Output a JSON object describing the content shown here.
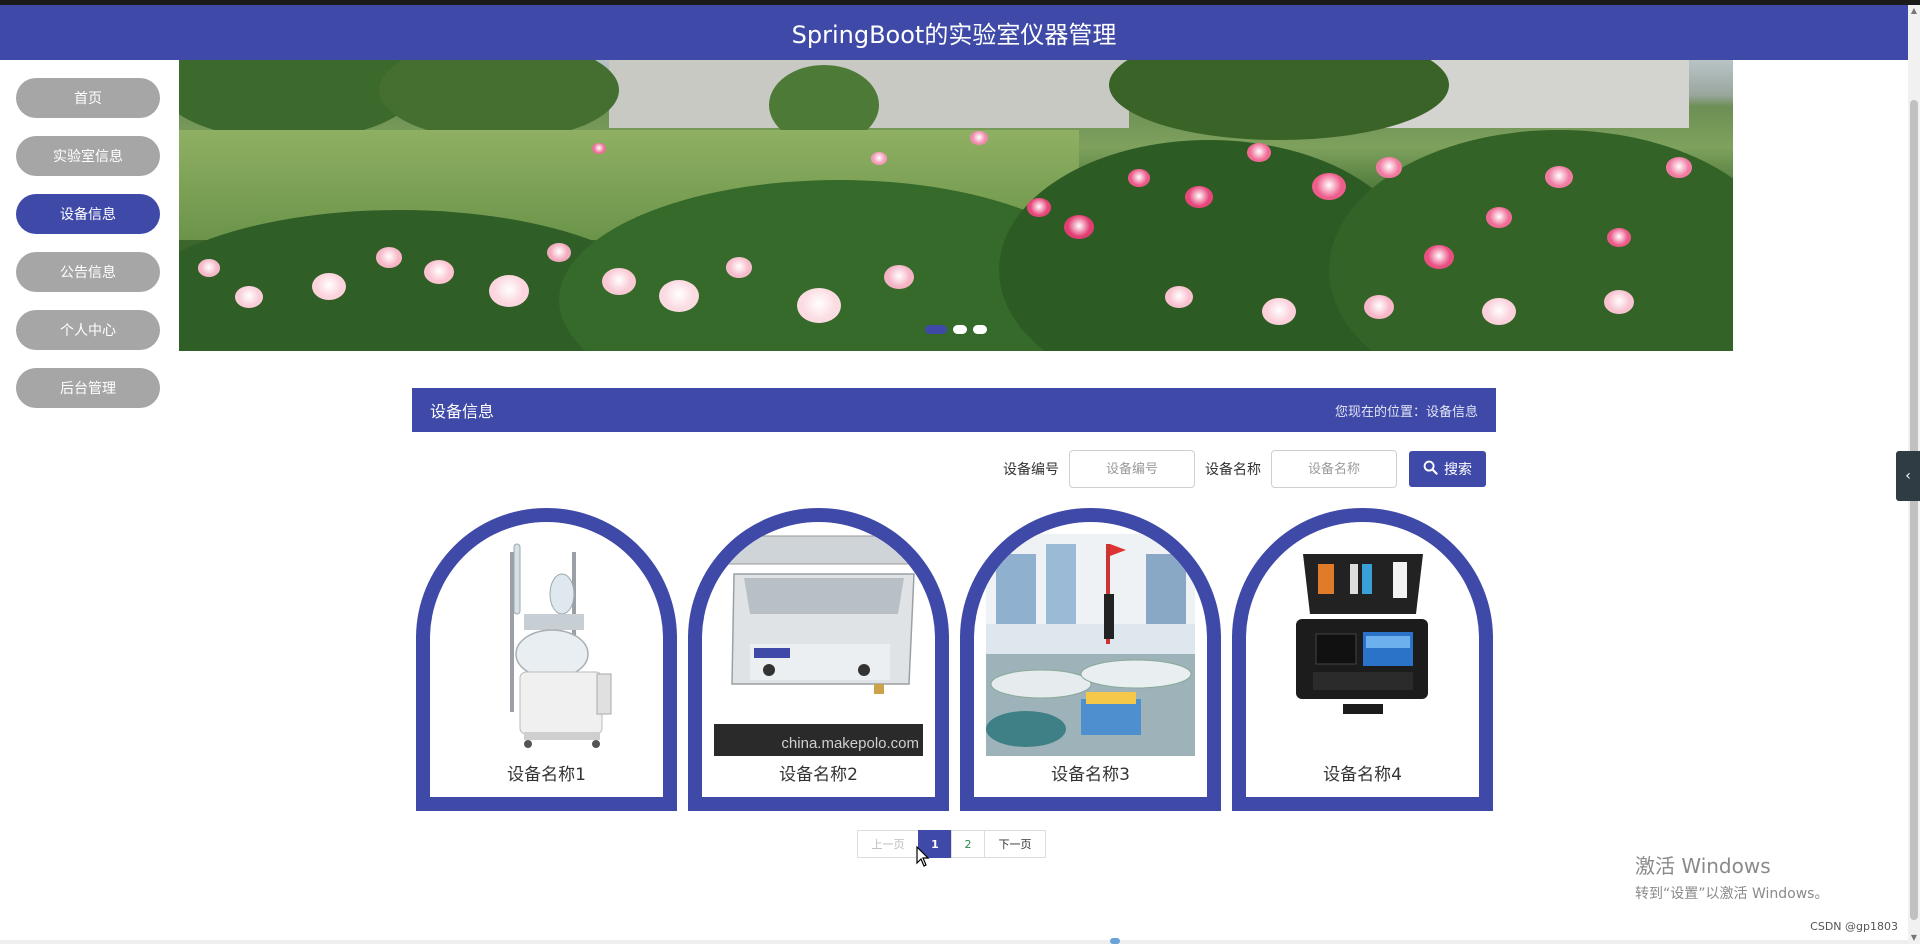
{
  "app": {
    "title": "SpringBoot的实验室仪器管理"
  },
  "theme": {
    "accent": "#3f4aa8",
    "nav_inactive": "#a6a6a6"
  },
  "sidebar": {
    "items": [
      {
        "label": "首页",
        "active": false
      },
      {
        "label": "实验室信息",
        "active": false
      },
      {
        "label": "设备信息",
        "active": true
      },
      {
        "label": "公告信息",
        "active": false
      },
      {
        "label": "个人中心",
        "active": false
      },
      {
        "label": "后台管理",
        "active": false
      }
    ]
  },
  "banner": {
    "slides": 3,
    "active_slide": 1
  },
  "section": {
    "title": "设备信息",
    "breadcrumb": "您现在的位置：设备信息"
  },
  "search": {
    "code_label": "设备编号",
    "code_placeholder": "设备编号",
    "name_label": "设备名称",
    "name_placeholder": "设备名称",
    "button_label": "搜索",
    "button_icon": "search-icon"
  },
  "devices": [
    {
      "name": "设备名称1",
      "image": "glass-reactor"
    },
    {
      "name": "设备名称2",
      "image": "ultrasonic-cleaner",
      "image_caption": "china.makepolo.com"
    },
    {
      "name": "设备名称3",
      "image": "lab-room"
    },
    {
      "name": "设备名称4",
      "image": "test-kit-case"
    }
  ],
  "pagination": {
    "prev": "上一页",
    "pages": [
      "1",
      "2"
    ],
    "current": "1",
    "next": "下一页"
  },
  "os_overlay": {
    "activate_title": "激活 Windows",
    "activate_sub": "转到“设置”以激活 Windows。",
    "watermark": "CSDN @gp1803"
  }
}
